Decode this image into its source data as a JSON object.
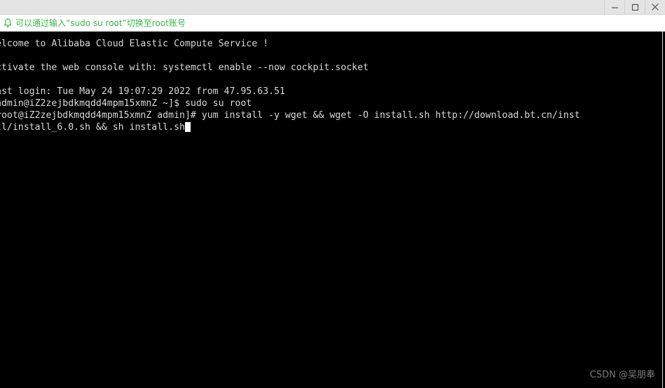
{
  "window": {
    "titlebar": {
      "title": "",
      "buttons": [
        {
          "name": "minimize",
          "label": "—",
          "icon": "minimize-icon"
        },
        {
          "name": "maximize",
          "label": "❐",
          "icon": "maximize-icon"
        },
        {
          "name": "close",
          "label": "✕",
          "icon": "close-icon"
        }
      ]
    },
    "notification": {
      "icon": "bell-icon",
      "text": "可以通过输入“sudo su root”切换至root账号",
      "text_color": "#3cb44a"
    }
  },
  "terminal": {
    "background": "#000000",
    "foreground": "#d9d9d9",
    "cursor": "block",
    "lines": [
      "elcome to Alibaba Cloud Elastic Compute Service !",
      "",
      "ctivate the web console with: systemctl enable --now cockpit.socket",
      "",
      "ast login: Tue May 24 19:07:29 2022 from 47.95.63.51",
      "admin@iZ2zejbdkmqdd4mpm15xmnZ ~]$ sudo su root",
      "root@iZ2zejbdkmqdd4mpm15xmnZ admin]# yum install -y wget && wget -O install.sh http://download.bt.cn/inst",
      "ll/install_6.0.sh && sh install.sh"
    ]
  },
  "watermark": {
    "text": "CSDN @吴朋奉"
  }
}
